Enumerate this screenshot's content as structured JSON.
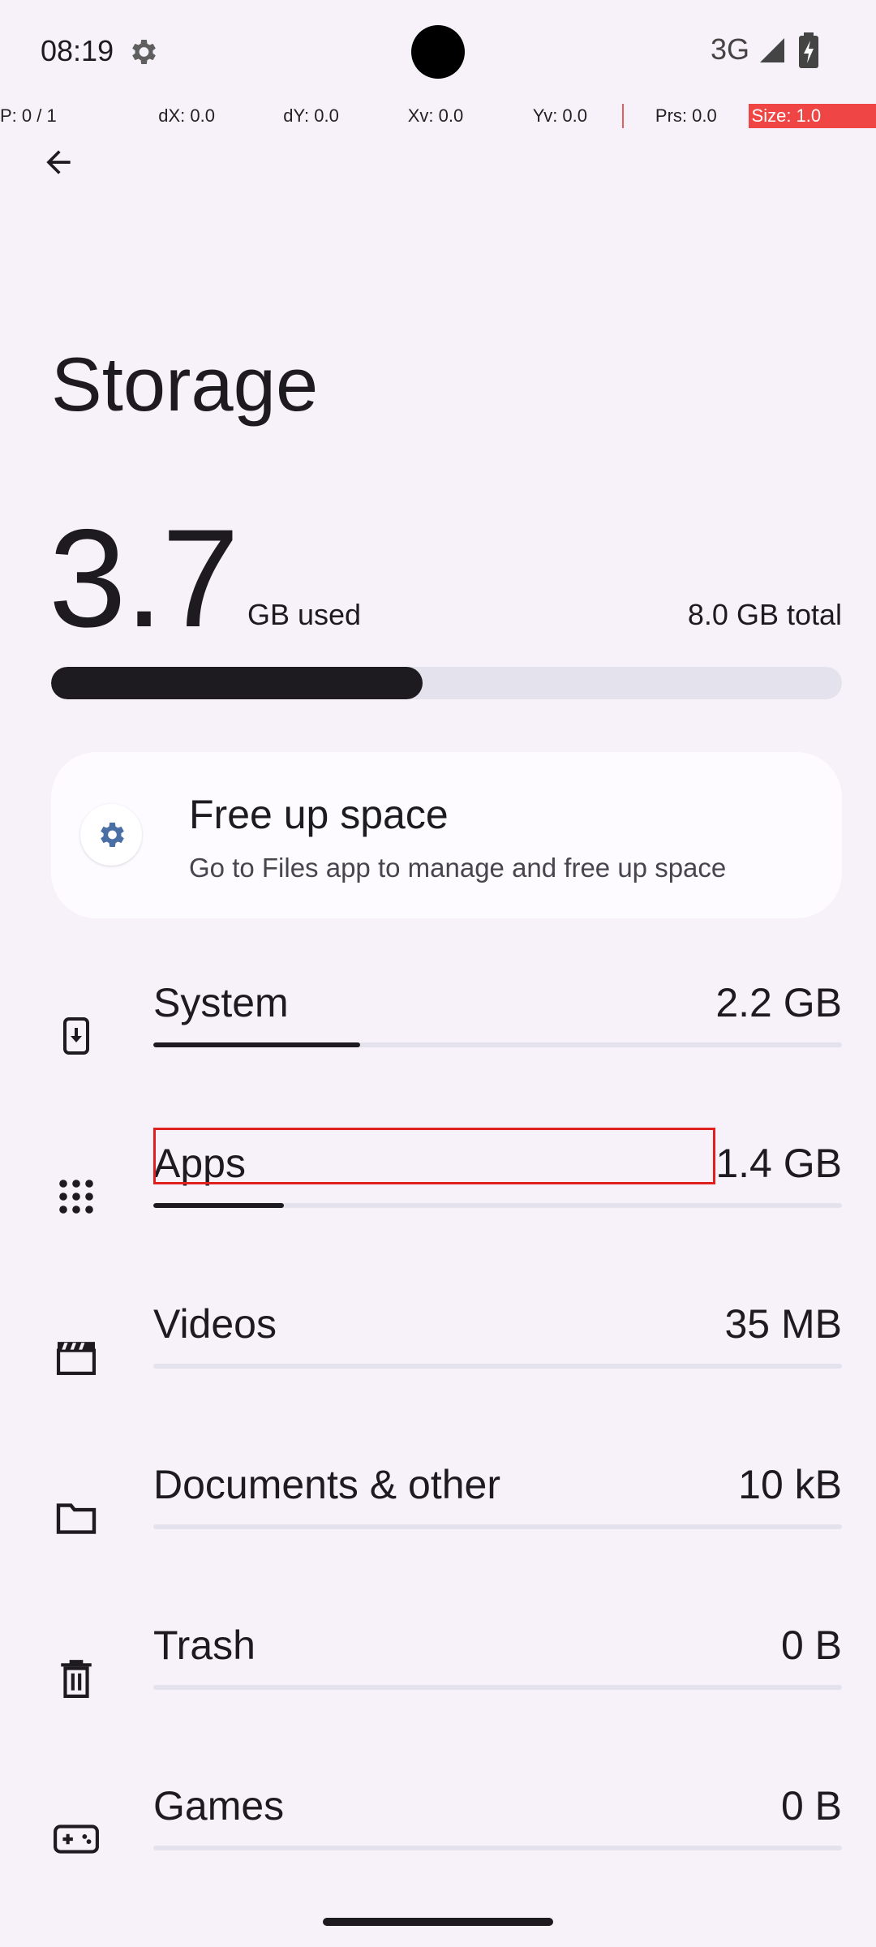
{
  "status_bar": {
    "time": "08:19",
    "network": "3G",
    "icons": [
      "settings-gear-icon",
      "signal-icon",
      "battery-charging-icon"
    ]
  },
  "debug_overlay": {
    "pointer": "P: 0 / 1",
    "dx": "dX: 0.0",
    "dy": "dY: 0.0",
    "xv": "Xv: 0.0",
    "yv": "Yv: 0.0",
    "prs": "Prs: 0.0",
    "size": "Size: 1.0"
  },
  "header": {
    "back_icon": "arrow-back-icon",
    "title": "Storage"
  },
  "summary": {
    "used_value": "3.7",
    "used_unit": "GB used",
    "total": "8.0 GB total",
    "used_fraction": 0.47
  },
  "free_up": {
    "icon": "files-settings-icon",
    "title": "Free up space",
    "subtitle": "Go to Files app to manage and free up space"
  },
  "categories": [
    {
      "label": "System",
      "value": "2.2 GB",
      "icon": "system-update-icon",
      "fraction": 0.3
    },
    {
      "label": "Apps",
      "value": "1.4 GB",
      "icon": "apps-grid-icon",
      "fraction": 0.19
    },
    {
      "label": "Videos",
      "value": "35 MB",
      "icon": "movie-clapper-icon",
      "fraction": 0.0
    },
    {
      "label": "Documents & other",
      "value": "10 kB",
      "icon": "folder-icon",
      "fraction": 0.0
    },
    {
      "label": "Trash",
      "value": "0 B",
      "icon": "trash-icon",
      "fraction": 0.0
    },
    {
      "label": "Games",
      "value": "0 B",
      "icon": "gamepad-icon",
      "fraction": 0.0
    }
  ],
  "colors": {
    "background": "#f7f2fa",
    "accent": "#1d1b20",
    "track": "#e4e2ec",
    "highlight": "#e0201f"
  }
}
